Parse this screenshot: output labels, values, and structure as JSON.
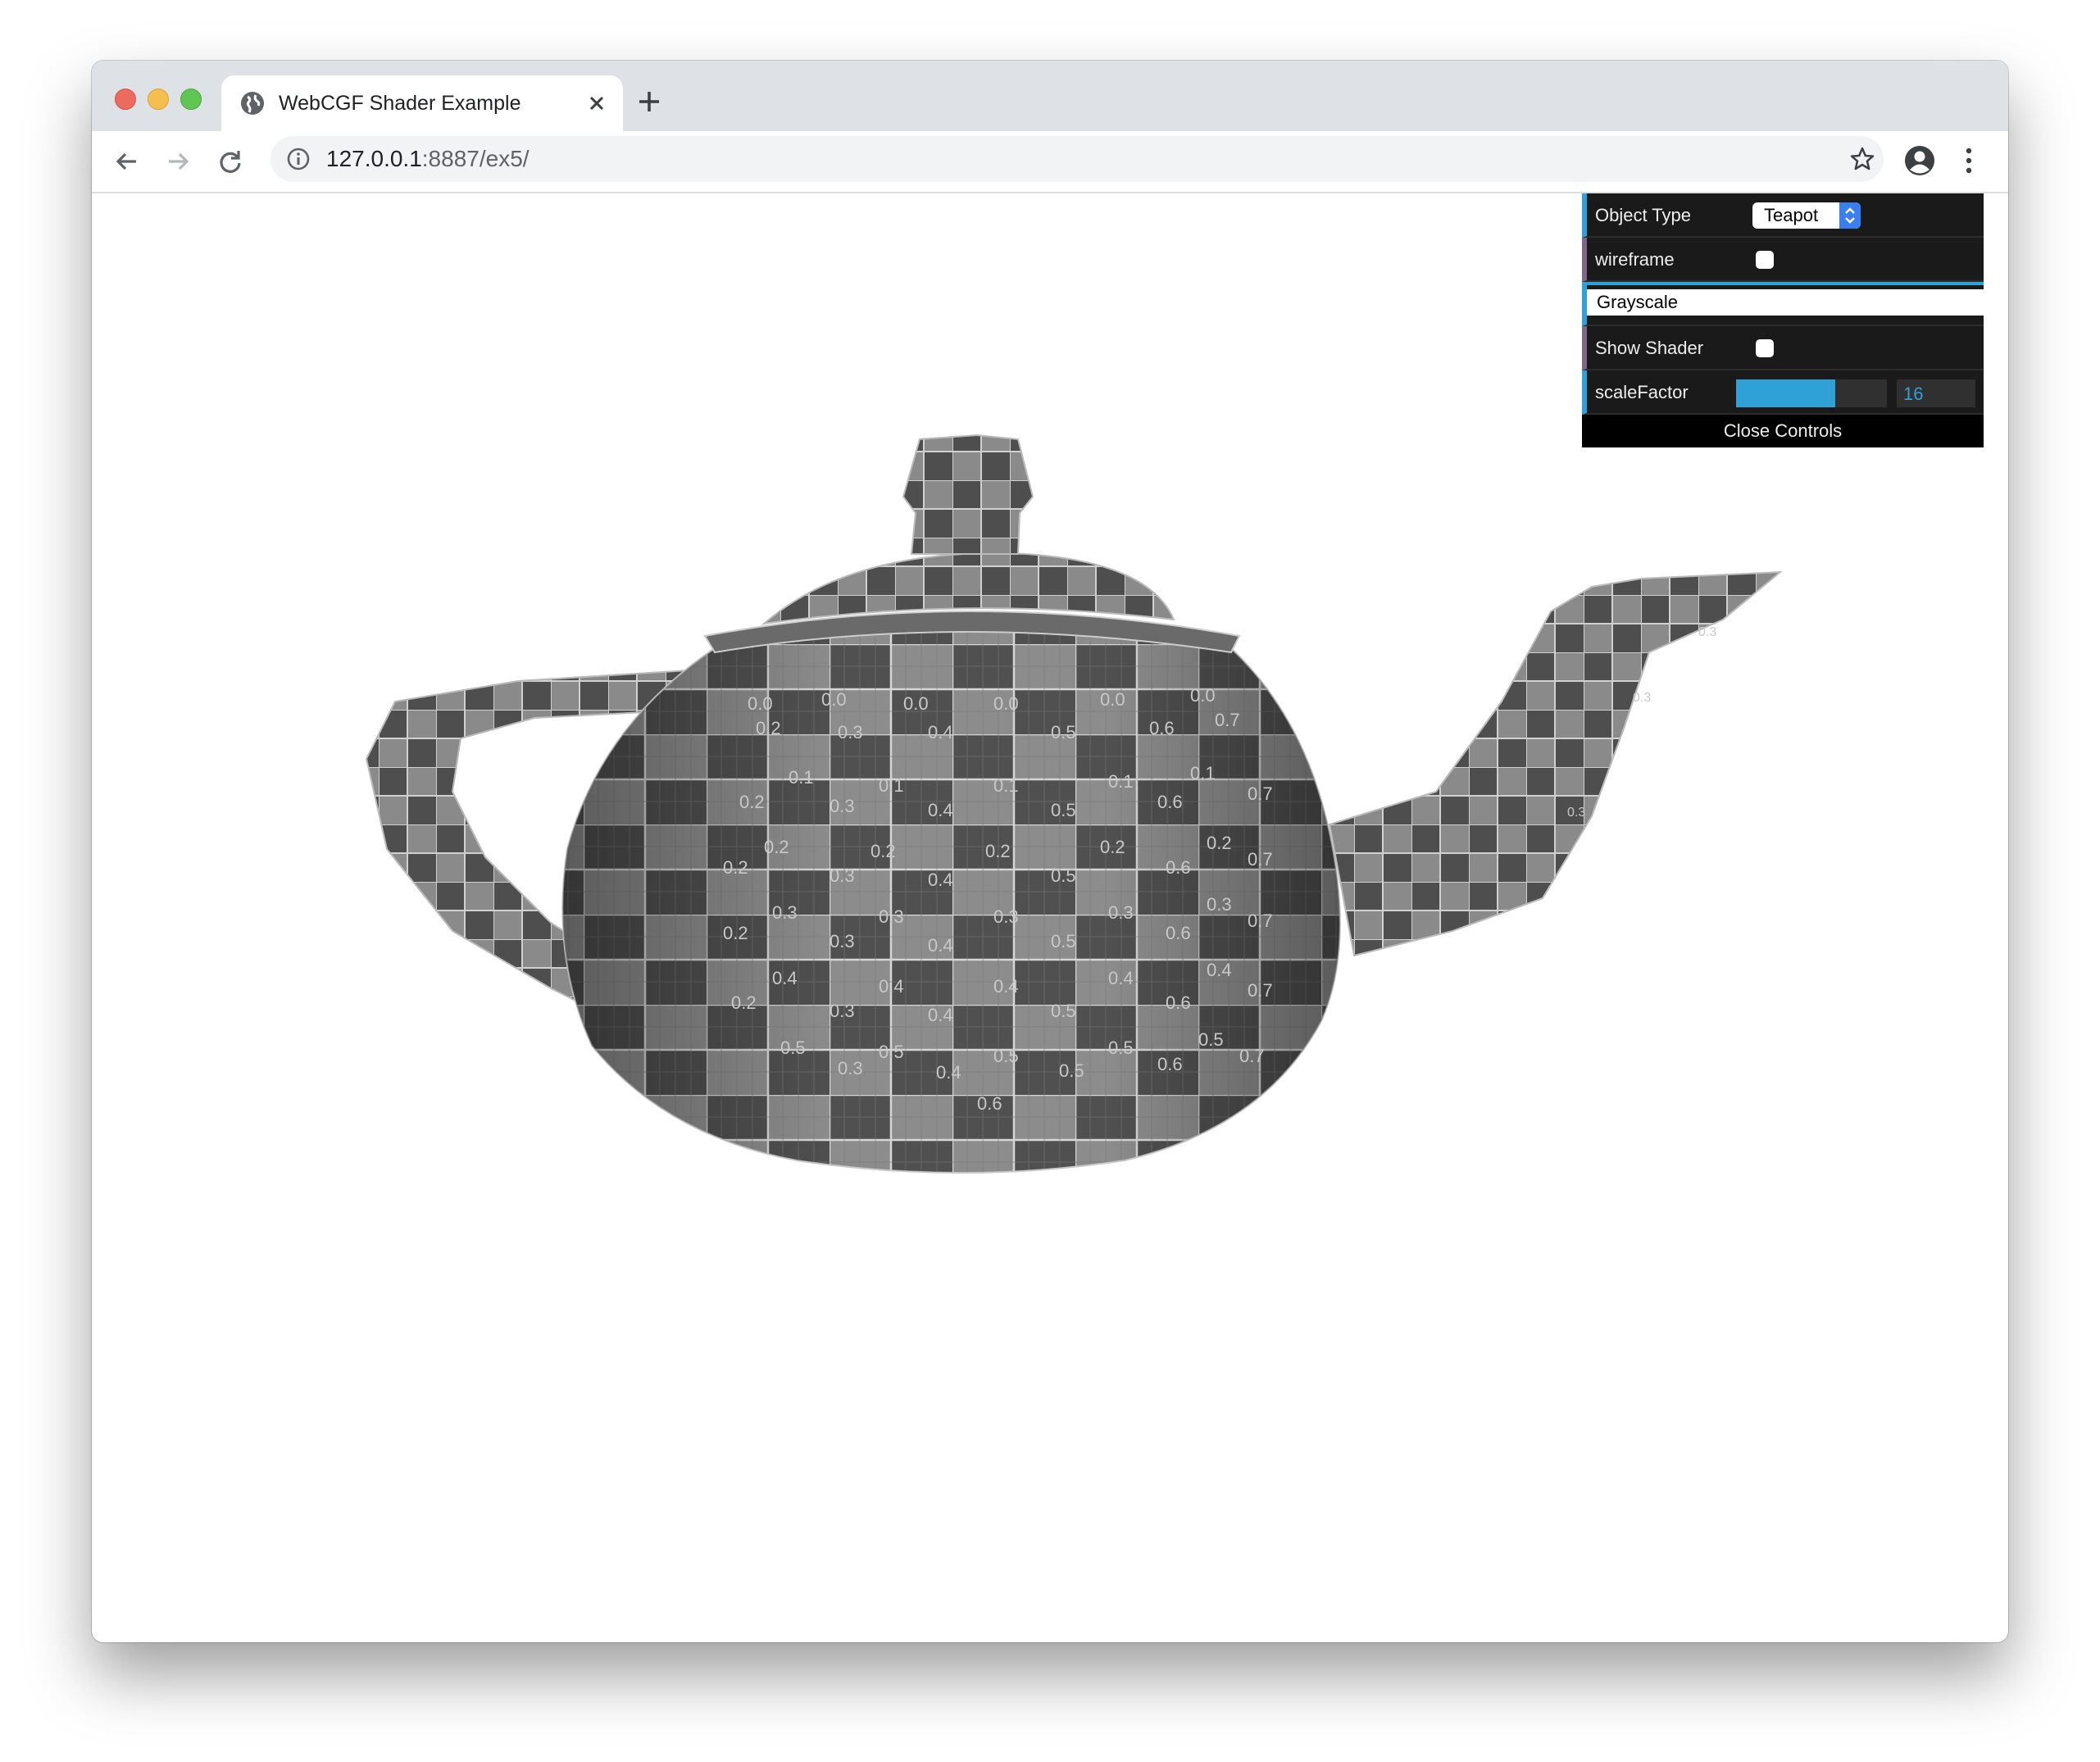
{
  "browser": {
    "tab_title": "WebCGF Shader Example",
    "url_host": "127.0.0.1",
    "url_path": ":8887/ex5/"
  },
  "gui": {
    "object_type_label": "Object Type",
    "object_type_value": "Teapot",
    "wireframe_label": "wireframe",
    "wireframe_checked": false,
    "shader_button_label": "Grayscale",
    "show_shader_label": "Show Shader",
    "show_shader_checked": false,
    "scale_factor_label": "scaleFactor",
    "scale_factor_value": "16",
    "scale_factor_fraction": 0.66,
    "close_label": "Close Controls"
  },
  "colors": {
    "gui_accent": "#2fa1d6",
    "gui_bg": "#1a1a1a",
    "chrome_bg": "#dee1e6"
  },
  "scene": {
    "object": "teapot",
    "texture_labels": [
      "0.0",
      "0.1",
      "0.2",
      "0.3",
      "0.4",
      "0.5",
      "0.6",
      "0.7"
    ]
  }
}
